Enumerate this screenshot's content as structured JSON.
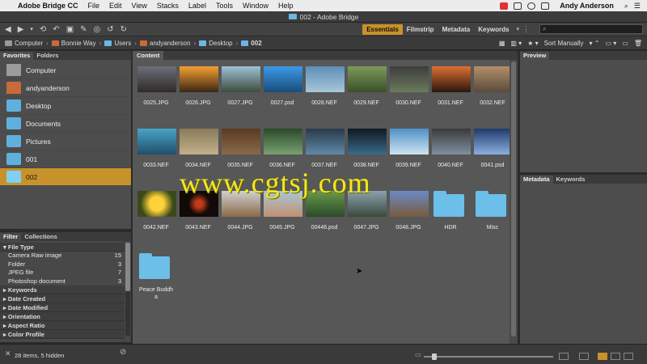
{
  "menubar": {
    "app": "Adobe Bridge CC",
    "items": [
      "File",
      "Edit",
      "View",
      "Stacks",
      "Label",
      "Tools",
      "Window",
      "Help"
    ],
    "user": "Andy Anderson"
  },
  "window": {
    "title": "002 - Adobe Bridge"
  },
  "toolbar": {
    "workspaces": [
      "Essentials",
      "Filmstrip",
      "Metadata",
      "Keywords"
    ],
    "active_workspace": "Essentials",
    "search_placeholder": "⌕"
  },
  "pathbar": {
    "crumbs": [
      "Computer",
      "Bonnie Way",
      "Users",
      "andyanderson",
      "Desktop",
      "002"
    ],
    "sort": "Sort Manually"
  },
  "left_panel": {
    "tabs": [
      "Favorites",
      "Folders"
    ],
    "favorites": [
      "Computer",
      "andyanderson",
      "Desktop",
      "Documents",
      "Pictures",
      "001",
      "002"
    ]
  },
  "filter_panel": {
    "tabs": [
      "Filter",
      "Collections"
    ],
    "section_file_type": "File Type",
    "rows": [
      {
        "label": "Camera Raw image",
        "count": "15"
      },
      {
        "label": "Folder",
        "count": "3"
      },
      {
        "label": "JPEG file",
        "count": "7"
      },
      {
        "label": "Photoshop document",
        "count": "3"
      }
    ],
    "sections": [
      "Keywords",
      "Date Created",
      "Date Modified",
      "Orientation",
      "Aspect Ratio",
      "Color Profile"
    ]
  },
  "content": {
    "tab": "Content",
    "items": [
      "0025.JPG",
      "0026.JPG",
      "0027.JPG",
      "0027.psd",
      "0028.NEF",
      "0029.NEF",
      "0030.NEF",
      "0031.NEF",
      "0032.NEF",
      "0033.NEF",
      "0034.NEF",
      "0035.NEF",
      "0036.NEF",
      "0037.NEF",
      "0038.NEF",
      "0039.NEF",
      "0040.NEF",
      "0041.psd",
      "0042.NEF",
      "0043.NEF",
      "0044.JPG",
      "0045.JPG",
      "00446.psd",
      "0047.JPG",
      "0048.JPG",
      "HDR",
      "Misc",
      "Peace Buddh\na"
    ]
  },
  "right_panels": {
    "preview_tab": "Preview",
    "meta_tabs": [
      "Metadata",
      "Keywords"
    ]
  },
  "status": {
    "info": "28 items, 5 hidden"
  },
  "watermark": "www.cgtsj.com"
}
